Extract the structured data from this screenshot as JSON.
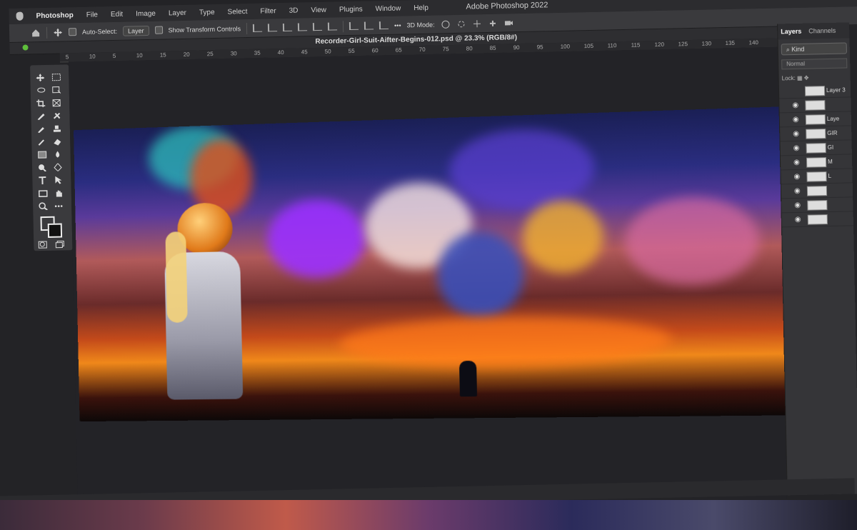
{
  "menubar": {
    "app_name": "Photoshop",
    "items": [
      "File",
      "Edit",
      "Image",
      "Layer",
      "Type",
      "Select",
      "Filter",
      "3D",
      "View",
      "Plugins",
      "Window",
      "Help"
    ],
    "window_title": "Adobe Photoshop 2022"
  },
  "options_bar": {
    "auto_select_label": "Auto-Select:",
    "auto_select_value": "Layer",
    "show_transform_label": "Show Transform Controls",
    "more": "•••",
    "mode_3d_label": "3D Mode:"
  },
  "document": {
    "tab_title": "Recorder-Girl-Suit-Aifter-Begins-012.psd @ 23.3% (RGB/8#)"
  },
  "ruler": {
    "ticks": [
      "5",
      "10",
      "5",
      "10",
      "15",
      "20",
      "25",
      "30",
      "35",
      "40",
      "45",
      "50",
      "55",
      "60",
      "65",
      "70",
      "75",
      "80",
      "85",
      "90",
      "95",
      "100",
      "105",
      "110",
      "115",
      "120",
      "125",
      "130",
      "135",
      "140"
    ]
  },
  "layers_panel": {
    "tabs": [
      "Layers",
      "Channels"
    ],
    "kind_label": "Kind",
    "blend_mode": "Normal",
    "lock_label": "Lock:",
    "layers": [
      {
        "name": "Layer 3",
        "visible": false
      },
      {
        "name": "",
        "visible": true
      },
      {
        "name": "Laye",
        "visible": true
      },
      {
        "name": "GIR",
        "visible": true
      },
      {
        "name": "GI",
        "visible": true
      },
      {
        "name": "M",
        "visible": true
      },
      {
        "name": "L",
        "visible": true
      },
      {
        "name": "",
        "visible": true
      },
      {
        "name": "",
        "visible": true
      },
      {
        "name": "",
        "visible": true
      }
    ]
  }
}
